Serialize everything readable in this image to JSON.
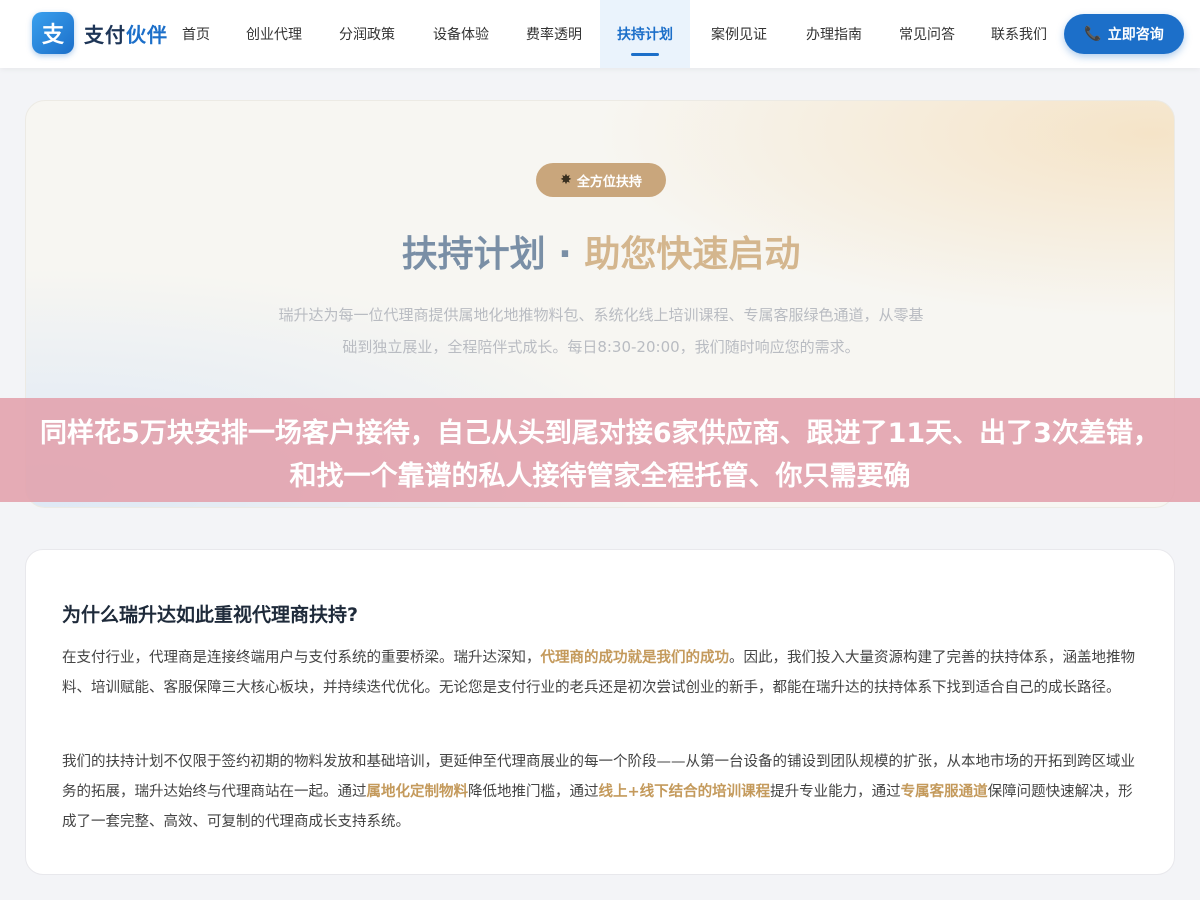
{
  "header": {
    "logo_badge": "支",
    "logo_text_main": "支付",
    "logo_text_accent": "伙伴",
    "nav": [
      {
        "label": "首页",
        "width": 64
      },
      {
        "label": "创业代理",
        "width": 92
      },
      {
        "label": "分润政策",
        "width": 94
      },
      {
        "label": "设备体验",
        "width": 94
      },
      {
        "label": "费率透明",
        "width": 92
      },
      {
        "label": "扶持计划",
        "width": 90,
        "active": true
      },
      {
        "label": "案例见证",
        "width": 98
      },
      {
        "label": "办理指南",
        "width": 92
      },
      {
        "label": "常见问答",
        "width": 94
      },
      {
        "label": "联系我们",
        "width": 90
      }
    ],
    "cta_label": "立即咨询"
  },
  "hero": {
    "badge": "全方位扶持",
    "title_main": "扶持计划 · ",
    "title_accent": "助您快速启动",
    "description": "瑞升达为每一位代理商提供属地化地推物料包、系统化线上培训课程、专属客服绿色通道，从零基础到独立展业，全程陪伴式成长。每日8:30-20:00，我们随时响应您的需求。"
  },
  "overlay": {
    "text": "同样花5万块安排一场客户接待，自己从头到尾对接6家供应商、跟进了11天、出了3次差错，和找一个靠谱的私人接待管家全程托管、你只需要确"
  },
  "section": {
    "title": "为什么瑞升达如此重视代理商扶持?",
    "p1_a": "在支付行业，代理商是连接终端用户与支付系统的重要桥梁。瑞升达深知，",
    "p1_hl": "代理商的成功就是我们的成功",
    "p1_b": "。因此，我们投入大量资源构建了完善的扶持体系，涵盖地推物料、培训赋能、客服保障三大核心板块，并持续迭代优化。无论您是支付行业的老兵还是初次尝试创业的新手，都能在瑞升达的扶持体系下找到适合自己的成长路径。",
    "p2_a": "我们的扶持计划不仅限于签约初期的物料发放和基础培训，更延伸至代理商展业的每一个阶段——从第一台设备的铺设到团队规模的扩张，从本地市场的开拓到跨区域业务的拓展，瑞升达始终与代理商站在一起。通过",
    "p2_hl1": "属地化定制物料",
    "p2_b": "降低地推门槛，通过",
    "p2_hl2": "线上+线下结合的培训课程",
    "p2_c": "提升专业能力，通过",
    "p2_hl3": "专属客服通道",
    "p2_d": "保障问题快速解决，形成了一套完整、高效、可复制的代理商成长支持系统。"
  },
  "colors": {
    "primary": "#1c6fc9",
    "gold": "#c9a67c",
    "highlight": "#c49a5c",
    "overlay": "#e2a0ac"
  }
}
